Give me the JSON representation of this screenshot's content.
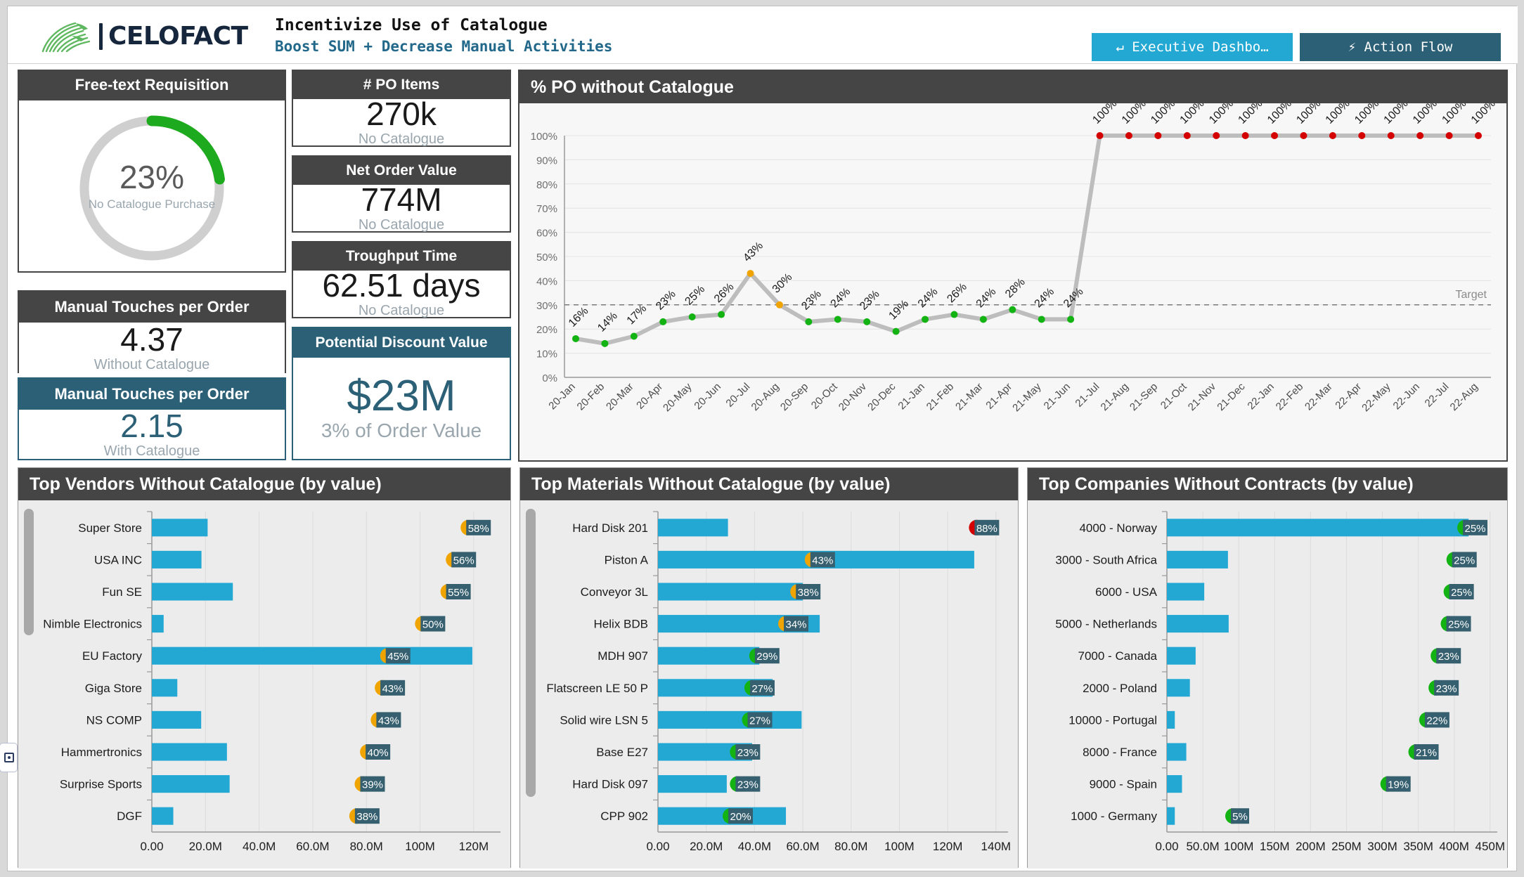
{
  "header": {
    "brand": "CELOFACT",
    "logo_icon": "celofact-fern-logo",
    "title": "Incentivize Use of Catalogue",
    "subtitle": "Boost SUM + Decrease Manual Activities",
    "buttons": [
      {
        "label": "↵ Executive Dashbo…",
        "icon": "enter-arrow-icon",
        "style": "cyan"
      },
      {
        "label": "⚡ Action Flow",
        "icon": "lightning-icon",
        "style": "dark"
      }
    ]
  },
  "gauge": {
    "title": "Free-text Requisition",
    "value": "23%",
    "value_num": 23,
    "caption": "No Catalogue Purchase",
    "arc_color": "#1eaa1e",
    "track_color": "#cfcfcf"
  },
  "kpis": [
    {
      "title": "# PO Items",
      "value": "270k",
      "caption": "No Catalogue",
      "style": "dark"
    },
    {
      "title": "Net Order Value",
      "value": "774M",
      "caption": "No Catalogue",
      "style": "dark"
    },
    {
      "title": "Troughput Time",
      "value": "62.51 days",
      "caption": "No Catalogue",
      "style": "dark"
    },
    {
      "title": "Potential Discount Value",
      "value": "$23M",
      "caption": "3% of Order Value",
      "style": "teal"
    }
  ],
  "kpis_left": [
    {
      "title": "Manual Touches per Order",
      "value": "4.37",
      "caption": "Without Catalogue",
      "style": "dark"
    },
    {
      "title": "Manual Touches per Order",
      "value": "2.15",
      "caption": "With Catalogue",
      "style": "teal"
    }
  ],
  "panels": {
    "line_title": "% PO without Catalogue",
    "vendors_title": "Top Vendors Without Catalogue (by value)",
    "materials_title": "Top Materials Without Catalogue (by value)",
    "companies_title": "Top Companies Without Contracts (by value)"
  },
  "chart_data": [
    {
      "id": "po_without_catalogue",
      "type": "line",
      "title": "% PO without Catalogue",
      "xlabel": "",
      "ylabel": "",
      "ylim": [
        0,
        100
      ],
      "yticks": [
        "0%",
        "10%",
        "20%",
        "30%",
        "40%",
        "50%",
        "60%",
        "70%",
        "80%",
        "90%",
        "100%"
      ],
      "grid": true,
      "target": 30,
      "target_label": "Target",
      "x": [
        "20-Jan",
        "20-Feb",
        "20-Mar",
        "20-Apr",
        "20-May",
        "20-Jun",
        "20-Jul",
        "20-Aug",
        "20-Sep",
        "20-Oct",
        "20-Nov",
        "20-Dec",
        "21-Jan",
        "21-Feb",
        "21-Mar",
        "21-Apr",
        "21-May",
        "21-Jun",
        "21-Jul",
        "21-Aug",
        "21-Sep",
        "21-Oct",
        "21-Nov",
        "21-Dec",
        "22-Jan",
        "22-Feb",
        "22-Mar",
        "22-Apr",
        "22-May",
        "22-Jun",
        "22-Jul",
        "22-Aug"
      ],
      "values": [
        16,
        14,
        17,
        23,
        25,
        26,
        43,
        30,
        23,
        24,
        23,
        19,
        24,
        26,
        24,
        28,
        24,
        24,
        100,
        100,
        100,
        100,
        100,
        100,
        100,
        100,
        100,
        100,
        100,
        100,
        100,
        100
      ],
      "labels": [
        "16%",
        "14%",
        "17%",
        "23%",
        "25%",
        "26%",
        "43%",
        "30%",
        "23%",
        "24%",
        "23%",
        "19%",
        "24%",
        "26%",
        "24%",
        "28%",
        "24%",
        "24%",
        "100%",
        "100%",
        "100%",
        "100%",
        "100%",
        "100%",
        "100%",
        "100%",
        "100%",
        "100%",
        "100%",
        "100%",
        "100%",
        "100%"
      ],
      "point_colors": [
        "#12b312",
        "#12b312",
        "#12b312",
        "#12b312",
        "#12b312",
        "#12b312",
        "#f0a400",
        "#f0a400",
        "#12b312",
        "#12b312",
        "#12b312",
        "#12b312",
        "#12b312",
        "#12b312",
        "#12b312",
        "#12b312",
        "#12b312",
        "#12b312",
        "#d40000",
        "#d40000",
        "#d40000",
        "#d40000",
        "#d40000",
        "#d40000",
        "#d40000",
        "#d40000",
        "#d40000",
        "#d40000",
        "#d40000",
        "#d40000",
        "#d40000",
        "#d40000"
      ],
      "line_color": "#bdbdbd"
    },
    {
      "id": "top_vendors",
      "type": "bar",
      "orientation": "horizontal",
      "title": "Top Vendors Without Catalogue (by value)",
      "xlim": [
        0,
        130
      ],
      "xticks": [
        "0.00",
        "20.0M",
        "40.0M",
        "60.0M",
        "80.0M",
        "100M",
        "120M"
      ],
      "xtick_values": [
        0,
        20,
        40,
        60,
        80,
        100,
        120
      ],
      "categories": [
        "Super Store",
        "USA INC",
        "Fun SE",
        "Nimble Electronics",
        "EU Factory",
        "Giga Store",
        "NS COMP",
        "Hammertronics",
        "Surprise Sports",
        "DGF"
      ],
      "values": [
        20.8,
        18.5,
        30.2,
        4.4,
        119.5,
        9.5,
        18.4,
        28.0,
        29.0,
        8.0
      ],
      "marker_labels": [
        "58%",
        "56%",
        "55%",
        "50%",
        "45%",
        "43%",
        "43%",
        "40%",
        "39%",
        "38%"
      ],
      "marker_values": [
        58,
        56,
        55,
        50,
        45,
        43,
        43,
        40,
        39,
        38
      ],
      "marker_colors": [
        "#f0a400",
        "#f0a400",
        "#f0a400",
        "#f0a400",
        "#f0a400",
        "#f0a400",
        "#f0a400",
        "#f0a400",
        "#f0a400",
        "#f0a400"
      ],
      "marker_x": [
        118,
        112.5,
        110.5,
        101,
        88,
        86,
        84.5,
        80.5,
        78.5,
        76.5
      ],
      "bar_color": "#23a8d4"
    },
    {
      "id": "top_materials",
      "type": "bar",
      "orientation": "horizontal",
      "title": "Top Materials Without Catalogue (by value)",
      "xlim": [
        0,
        145
      ],
      "xticks": [
        "0.00",
        "20.0M",
        "40.0M",
        "60.0M",
        "80.0M",
        "100M",
        "120M",
        "140M"
      ],
      "xtick_values": [
        0,
        20,
        40,
        60,
        80,
        100,
        120,
        140
      ],
      "categories": [
        "Hard Disk 201",
        "Piston A",
        "Conveyor 3L",
        "Helix BDB",
        "MDH 907",
        "Flatscreen LE 50 P",
        "Solid wire LSN 5",
        "Base E27",
        "Hard Disk 097",
        "CPP 902"
      ],
      "values": [
        29.0,
        131.0,
        60.0,
        67.0,
        42.0,
        47.5,
        59.5,
        39.0,
        28.5,
        53.0
      ],
      "marker_labels": [
        "88%",
        "43%",
        "38%",
        "34%",
        "29%",
        "27%",
        "27%",
        "23%",
        "23%",
        "20%"
      ],
      "marker_values": [
        88,
        43,
        38,
        34,
        29,
        27,
        27,
        23,
        23,
        20
      ],
      "marker_colors": [
        "#d40000",
        "#f0a400",
        "#f0a400",
        "#f0a400",
        "#12b312",
        "#12b312",
        "#12b312",
        "#12b312",
        "#12b312",
        "#12b312"
      ],
      "marker_x": [
        132,
        64,
        58,
        53,
        41,
        39,
        38,
        33,
        33,
        30
      ],
      "bar_color": "#23a8d4"
    },
    {
      "id": "top_companies",
      "type": "bar",
      "orientation": "horizontal",
      "title": "Top Companies Without Contracts (by value)",
      "xlim": [
        0,
        460
      ],
      "xticks": [
        "0.00",
        "50.0M",
        "100M",
        "150M",
        "200M",
        "250M",
        "300M",
        "350M",
        "400M",
        "450M"
      ],
      "xtick_values": [
        0,
        50,
        100,
        150,
        200,
        250,
        300,
        350,
        400,
        450
      ],
      "categories": [
        "4000 - Norway",
        "3000 - South Africa",
        "6000 - USA",
        "5000 - Netherlands",
        "7000 - Canada",
        "2000 - Poland",
        "10000 - Portugal",
        "8000 - France",
        "9000 - Spain",
        "1000 - Germany"
      ],
      "values": [
        420,
        85,
        52,
        86,
        40,
        32,
        11,
        27,
        21,
        11
      ],
      "marker_labels": [
        "25%",
        "25%",
        "25%",
        "25%",
        "23%",
        "23%",
        "22%",
        "21%",
        "19%",
        "5%"
      ],
      "marker_values": [
        25,
        25,
        25,
        25,
        23,
        23,
        22,
        21,
        19,
        5
      ],
      "marker_colors": [
        "#12b312",
        "#12b312",
        "#12b312",
        "#12b312",
        "#12b312",
        "#12b312",
        "#12b312",
        "#12b312",
        "#12b312",
        "#12b312"
      ],
      "marker_x": [
        415,
        400,
        396,
        392,
        378,
        375,
        362,
        347,
        308,
        92
      ],
      "bar_color": "#23a8d4"
    }
  ],
  "colors": {
    "accent_cyan": "#23a8d4",
    "accent_teal": "#2c6077",
    "panel_header": "#454545",
    "green": "#12b312",
    "amber": "#f0a400",
    "red": "#d40000"
  }
}
